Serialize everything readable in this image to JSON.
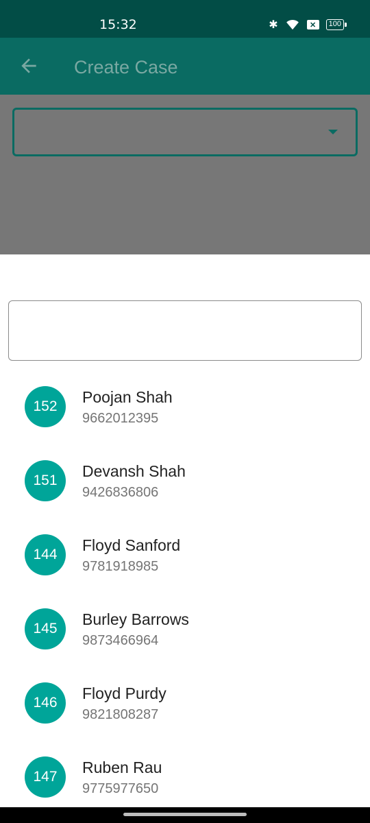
{
  "status_bar": {
    "time": "15:32",
    "battery": "100",
    "icons": [
      "bluetooth-icon",
      "wifi-icon",
      "x-notification-icon",
      "battery-icon"
    ]
  },
  "app_bar": {
    "title": "Create Case",
    "back_icon": "arrow-left-icon"
  },
  "dropdown": {
    "value": "",
    "icon": "caret-down-icon"
  },
  "sheet": {
    "search": {
      "value": "",
      "placeholder": ""
    },
    "items": [
      {
        "id": "152",
        "name": "Poojan Shah",
        "phone": "9662012395"
      },
      {
        "id": "151",
        "name": "Devansh Shah",
        "phone": "9426836806"
      },
      {
        "id": "144",
        "name": "Floyd Sanford",
        "phone": "9781918985"
      },
      {
        "id": "145",
        "name": "Burley Barrows",
        "phone": "9873466964"
      },
      {
        "id": "146",
        "name": "Floyd Purdy",
        "phone": "9821808287"
      },
      {
        "id": "147",
        "name": "Ruben Rau",
        "phone": "9775977650"
      }
    ]
  },
  "colors": {
    "primary_dark": "#024d46",
    "primary": "#0a6b62",
    "accent": "#00a599",
    "scrim": "#777777"
  }
}
